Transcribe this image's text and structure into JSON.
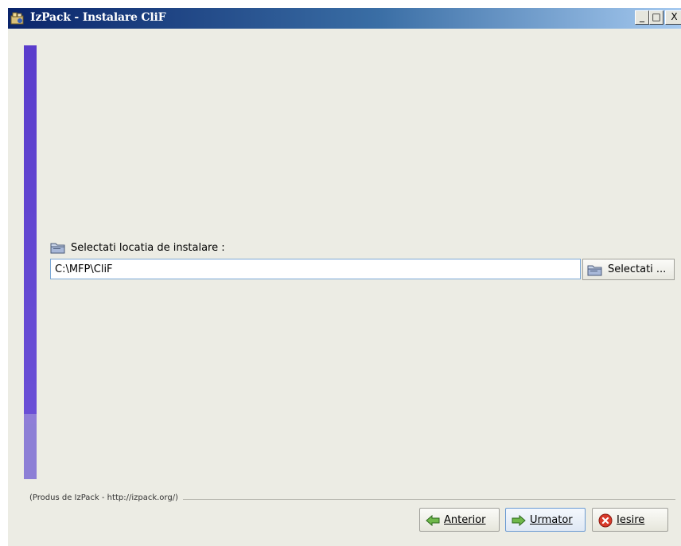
{
  "window": {
    "title": "IzPack - Instalare CliF",
    "controls": {
      "minimize": "_",
      "maximize": "□",
      "close": "X"
    }
  },
  "icons": {
    "app": "izpack-app-icon",
    "folder": "folder-icon",
    "arrow_left": "green-arrow-left-icon",
    "arrow_right": "green-arrow-right-icon",
    "exit": "red-x-icon"
  },
  "main": {
    "install_label": "Selectati locatia de instalare :",
    "path_value": "C:\\MFP\\CliF",
    "browse_label": "Selectati ..."
  },
  "footer": {
    "credit": "(Produs de IzPack - http://izpack.org/)"
  },
  "navigation": {
    "prev_label": "Anterior",
    "next_label": "Urmator",
    "exit_label": "Iesire"
  },
  "colors": {
    "titlebar_start": "#0a246a",
    "titlebar_end": "#a6caf0",
    "sidebar": "#5a3ccc",
    "window_bg": "#ecece4"
  }
}
